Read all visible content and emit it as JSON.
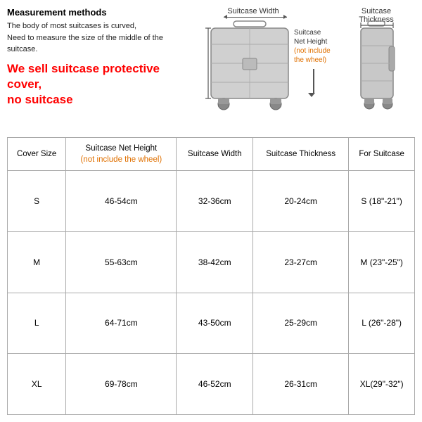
{
  "measurement": {
    "title": "Measurement methods",
    "desc_line1": "The body of most suitcases is curved,",
    "desc_line2": "Need to measure the size of the middle of the suitcase.",
    "sell_line1": "We sell suitcase protective cover,",
    "sell_line2": "no suitcase"
  },
  "diagram": {
    "label_width": "Suitcase Width",
    "label_thickness": "Suitcase Thickness",
    "label_height_line1": "Suitcase",
    "label_height_line2": "Net Height",
    "label_height_line3": "(not include",
    "label_height_line4": "the wheel)"
  },
  "table": {
    "headers": {
      "cover_size": "Cover Size",
      "net_height_line1": "Suitcase Net Height",
      "net_height_line2": "(not include the wheel)",
      "width": "Suitcase Width",
      "thickness": "Suitcase Thickness",
      "for_suitcase": "For Suitcase"
    },
    "rows": [
      {
        "size": "S",
        "height": "46-54cm",
        "width": "32-36cm",
        "thickness": "20-24cm",
        "for": "S (18\"-21\")"
      },
      {
        "size": "M",
        "height": "55-63cm",
        "width": "38-42cm",
        "thickness": "23-27cm",
        "for": "M (23\"-25\")"
      },
      {
        "size": "L",
        "height": "64-71cm",
        "width": "43-50cm",
        "thickness": "25-29cm",
        "for": "L (26\"-28\")"
      },
      {
        "size": "XL",
        "height": "69-78cm",
        "width": "46-52cm",
        "thickness": "26-31cm",
        "for": "XL(29\"-32\")"
      }
    ]
  }
}
